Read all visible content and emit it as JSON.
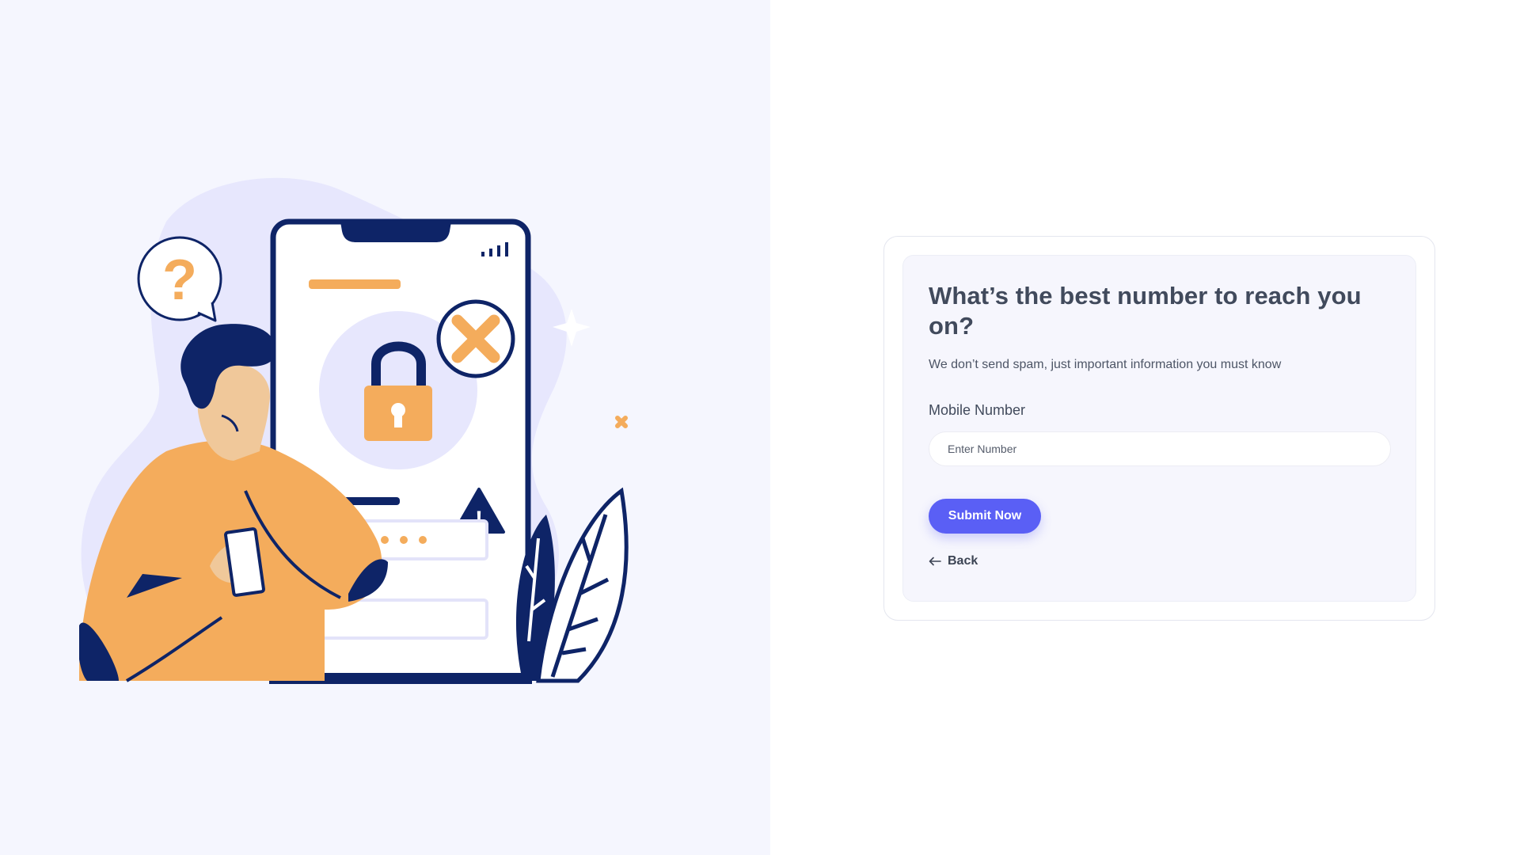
{
  "illustration": {
    "question_glyph": "?",
    "warning_glyph": "!",
    "icons": [
      "question-bubble-icon",
      "lock-icon",
      "error-x-icon",
      "warning-icon",
      "signal-icon",
      "sparkle-icon"
    ]
  },
  "form": {
    "title": "What’s the best number to reach you on?",
    "subtitle": "We don’t send spam, just important information you must know",
    "field_label": "Mobile Number",
    "input_placeholder": "Enter Number",
    "input_value": "",
    "submit_label": "Submit Now",
    "back_label": "Back",
    "back_icon": "arrow-left-icon"
  },
  "colors": {
    "left_background": "#f5f6fe",
    "accent": "#5a5ff5",
    "orange": "#f4ac5c",
    "navy": "#0e2467",
    "blob": "#e7e7fd"
  }
}
